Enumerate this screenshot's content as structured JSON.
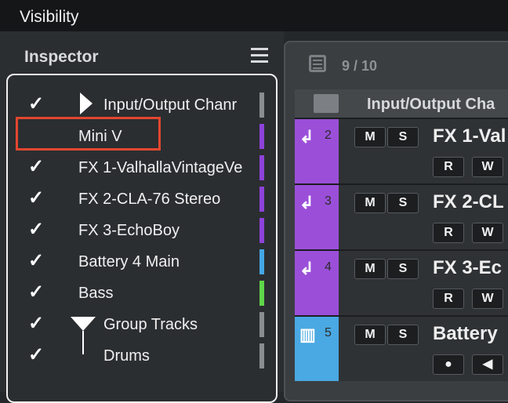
{
  "tabs": {
    "inspector": "Inspector",
    "visibility": "Visibility",
    "menu_icon": "hamburger-menu-icon"
  },
  "visibility_list": [
    {
      "label": "Input/Output Chanr",
      "checked": true,
      "color": "#8a8d90",
      "indent": true,
      "expander": "triangle-right"
    },
    {
      "label": "Mini V",
      "checked": false,
      "color": "#8e42d9",
      "indent": false,
      "highlighted": true
    },
    {
      "label": "FX 1-ValhallaVintageVe",
      "checked": true,
      "color": "#8e42d9",
      "indent": false
    },
    {
      "label": "FX 2-CLA-76 Stereo",
      "checked": true,
      "color": "#8e42d9",
      "indent": false
    },
    {
      "label": "FX 3-EchoBoy",
      "checked": true,
      "color": "#8e42d9",
      "indent": false
    },
    {
      "label": "Battery 4 Main",
      "checked": true,
      "color": "#44a7e6",
      "indent": false
    },
    {
      "label": "Bass",
      "checked": true,
      "color": "#5fd64a",
      "indent": false
    },
    {
      "label": "Group Tracks",
      "checked": true,
      "color": "#8a8d90",
      "indent": true,
      "expander": "folder-funnel"
    },
    {
      "label": "Drums",
      "checked": true,
      "color": "#8a8d90",
      "indent": true
    }
  ],
  "project": {
    "count": "9 / 10",
    "header_label": "Input/Output Cha",
    "tracks": [
      {
        "number": "2",
        "name": "FX 1-Val",
        "color": "#9b4fd9",
        "icon": "return-arrow-icon",
        "m": "M",
        "s": "S",
        "r": "R",
        "w": "W"
      },
      {
        "number": "3",
        "name": "FX 2-CL",
        "color": "#9b4fd9",
        "icon": "return-arrow-icon",
        "m": "M",
        "s": "S",
        "r": "R",
        "w": "W"
      },
      {
        "number": "4",
        "name": "FX 3-Ec",
        "color": "#9b4fd9",
        "icon": "return-arrow-icon",
        "m": "M",
        "s": "S",
        "r": "R",
        "w": "W"
      },
      {
        "number": "5",
        "name": "Battery",
        "color": "#4aa8e3",
        "icon": "keyboard-icon",
        "m": "M",
        "s": "S",
        "r": "●",
        "w": "◀"
      }
    ]
  }
}
